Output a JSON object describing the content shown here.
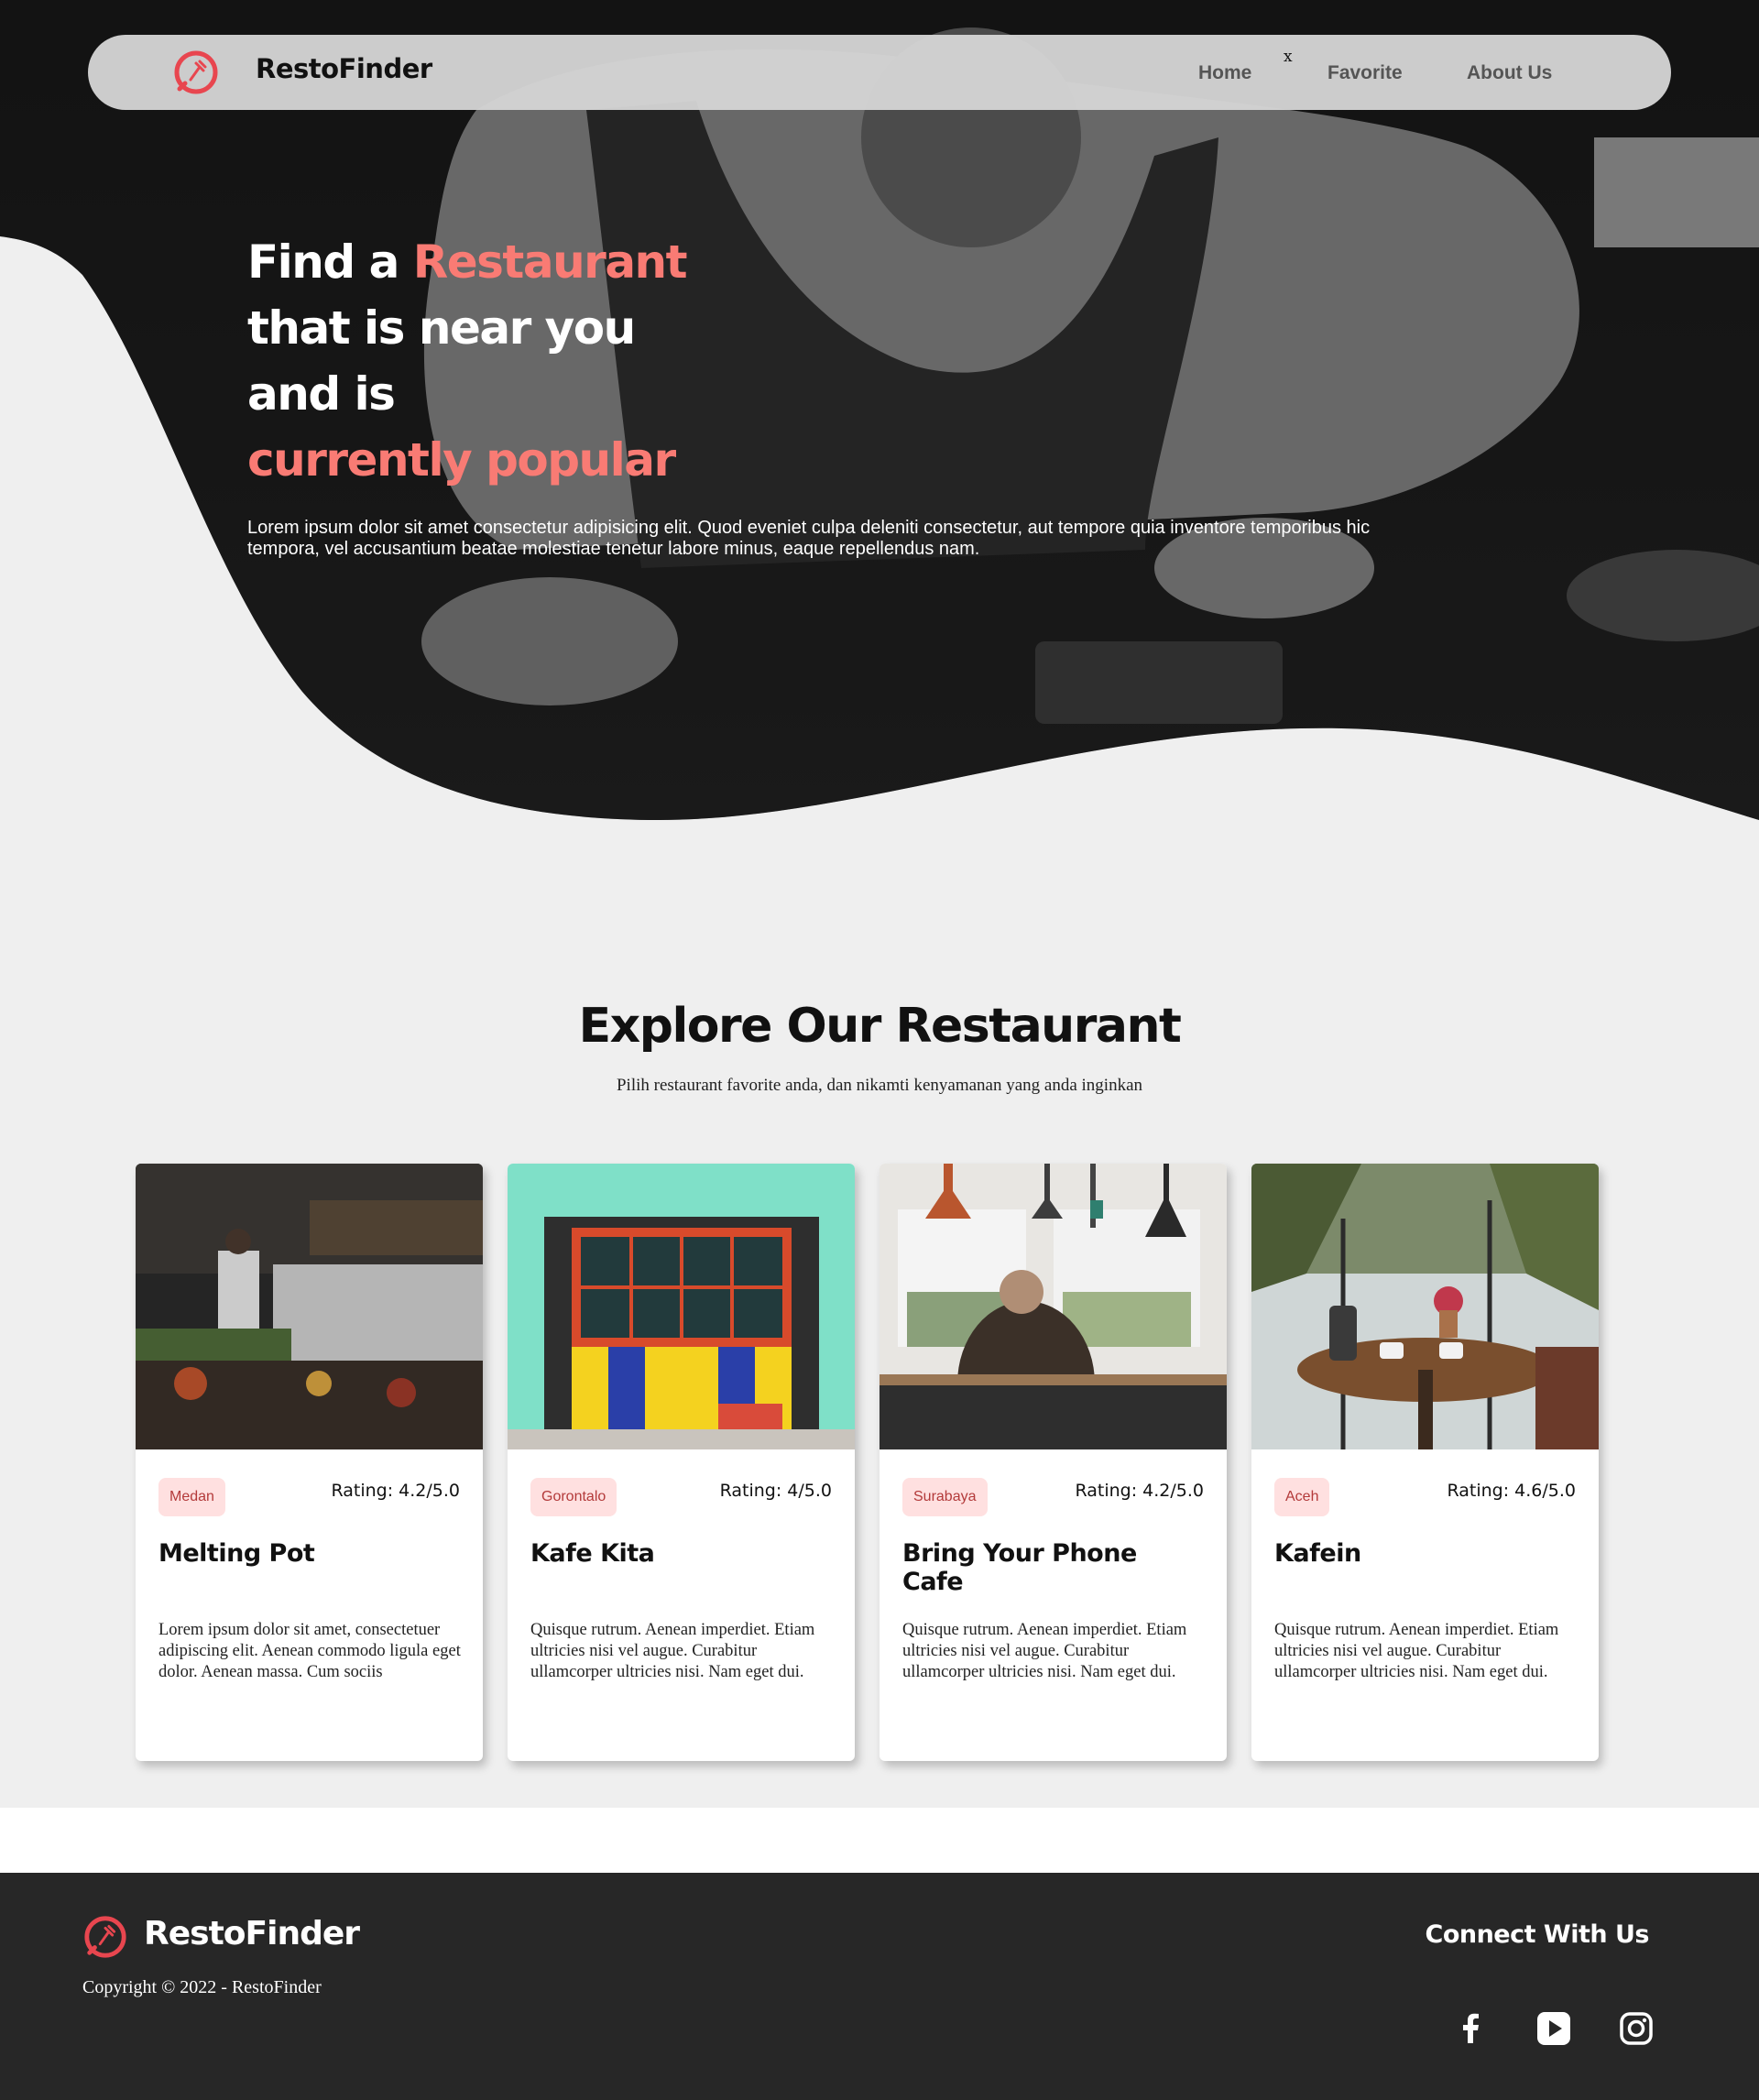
{
  "nav": {
    "brand": "RestoFinder",
    "close_glyph": "x",
    "links": [
      "Home",
      "Favorite",
      "About Us"
    ],
    "logo_icon": "fork-knife-icon"
  },
  "hero": {
    "title_part1": "Find a ",
    "title_accent1": "Restaurant",
    "title_line2": "that is near you",
    "title_line3": "and is",
    "title_accent2": "currently popular",
    "description": "Lorem ipsum dolor sit amet consectetur adipisicing elit. Quod eveniet culpa deleniti consectetur, aut tempore quia inventore temporibus hic tempora, vel accusantium beatae molestiae tenetur labore minus, eaque repellendus nam."
  },
  "explore": {
    "title": "Explore Our Restaurant",
    "subtitle": "Pilih restaurant favorite anda, dan nikamti kenyamanan yang anda inginkan"
  },
  "restaurants": [
    {
      "city": "Medan",
      "rating": "Rating: 4.2/5.0",
      "name": "Melting Pot",
      "description": "Lorem ipsum dolor sit amet, consectetuer adipiscing elit. Aenean commodo ligula eget dolor. Aenean massa. Cum sociis"
    },
    {
      "city": "Gorontalo",
      "rating": "Rating: 4/5.0",
      "name": "Kafe Kita",
      "description": "Quisque rutrum. Aenean imperdiet. Etiam ultricies nisi vel augue. Curabitur ullamcorper ultricies nisi. Nam eget dui."
    },
    {
      "city": "Surabaya",
      "rating": "Rating: 4.2/5.0",
      "name": "Bring Your Phone Cafe",
      "description": "Quisque rutrum. Aenean imperdiet. Etiam ultricies nisi vel augue. Curabitur ullamcorper ultricies nisi. Nam eget dui."
    },
    {
      "city": "Aceh",
      "rating": "Rating: 4.6/5.0",
      "name": "Kafein",
      "description": "Quisque rutrum. Aenean imperdiet. Etiam ultricies nisi vel augue. Curabitur ullamcorper ultricies nisi. Nam eget dui."
    }
  ],
  "footer": {
    "brand": "RestoFinder",
    "copyright": "Copyright © 2022 - RestoFinder",
    "connect": "Connect With Us",
    "social_icons": [
      "facebook-icon",
      "youtube-icon",
      "instagram-icon"
    ]
  },
  "colors": {
    "accent": "#f97b74",
    "logo": "#e8464f",
    "hero_dark": "#2f2f2f",
    "page_bg": "#efefef",
    "footer_bg": "#272727",
    "badge_bg": "#ffe0e0"
  }
}
